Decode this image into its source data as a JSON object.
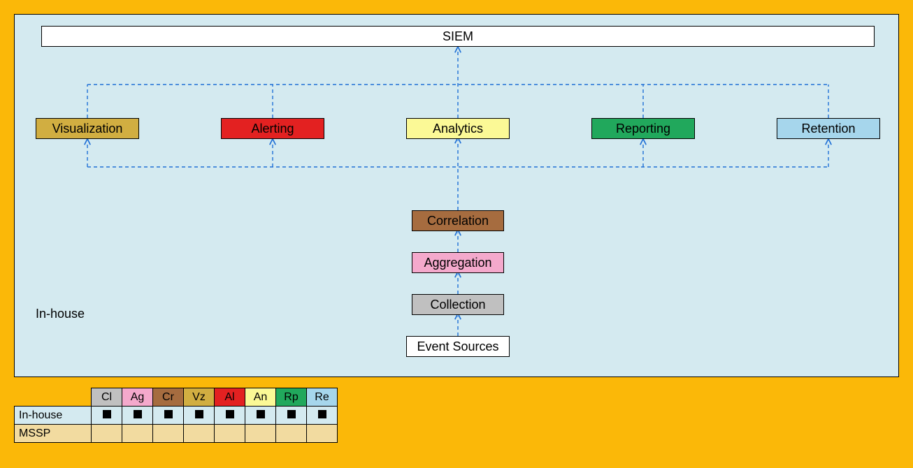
{
  "diagram": {
    "panel_label": "In-house",
    "siem_label": "SIEM",
    "row2": {
      "visualization": "Visualization",
      "alerting": "Alerting",
      "analytics": "Analytics",
      "reporting": "Reporting",
      "retention": "Retention"
    },
    "stack": {
      "correlation": "Correlation",
      "aggregation": "Aggregation",
      "collection": "Collection",
      "event_sources": "Event Sources"
    }
  },
  "legend": {
    "headers": {
      "cl": "Cl",
      "ag": "Ag",
      "cr": "Cr",
      "vz": "Vz",
      "al": "Al",
      "an": "An",
      "rp": "Rp",
      "re": "Re"
    },
    "row_labels": {
      "inhouse": "In-house",
      "mssp": "MSSP"
    },
    "colors": {
      "cl": "#c0c0c0",
      "ag": "#f4a9cc",
      "cr": "#a66c3f",
      "vz": "#d1ae41",
      "al": "#e32121",
      "an": "#fbf996",
      "rp": "#21a85c",
      "re": "#a6d6ec"
    },
    "inhouse_marks": [
      true,
      true,
      true,
      true,
      true,
      true,
      true,
      true
    ],
    "mssp_marks": [
      false,
      false,
      false,
      false,
      false,
      false,
      false,
      false
    ]
  }
}
